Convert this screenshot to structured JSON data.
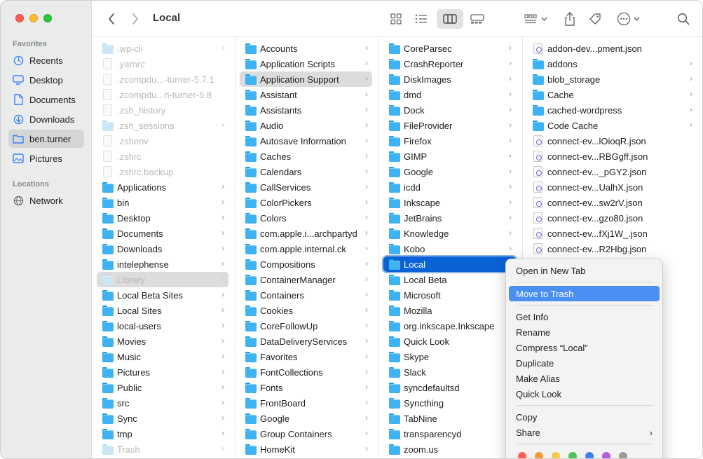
{
  "window": {
    "title": "Local"
  },
  "sidebar": {
    "favorites_label": "Favorites",
    "locations_label": "Locations",
    "favorites": [
      {
        "label": "Recents",
        "icon": "clock-icon"
      },
      {
        "label": "Desktop",
        "icon": "desktop-icon"
      },
      {
        "label": "Documents",
        "icon": "document-icon"
      },
      {
        "label": "Downloads",
        "icon": "download-icon"
      },
      {
        "label": "ben.turner",
        "icon": "home-folder-icon",
        "selected": true
      },
      {
        "label": "Pictures",
        "icon": "pictures-icon"
      }
    ],
    "locations": [
      {
        "label": "Network",
        "icon": "network-icon"
      }
    ]
  },
  "columns": [
    {
      "items": [
        {
          "name": ".wp-cli",
          "kind": "folder",
          "dim": true,
          "chevron": true
        },
        {
          "name": ".yarnrc",
          "kind": "doc",
          "dim": true
        },
        {
          "name": ".zcompdu...-turner-5.7.1",
          "kind": "doc",
          "dim": true
        },
        {
          "name": ".zcompdu...n-turner-5.8",
          "kind": "doc",
          "dim": true
        },
        {
          "name": ".zsh_history",
          "kind": "doc",
          "dim": true
        },
        {
          "name": ".zsh_sessions",
          "kind": "folder",
          "dim": true,
          "chevron": true
        },
        {
          "name": ".zshenv",
          "kind": "doc",
          "dim": true
        },
        {
          "name": ".zshrc",
          "kind": "doc",
          "dim": true
        },
        {
          "name": ".zshrc.backup",
          "kind": "doc",
          "dim": true
        },
        {
          "name": "Applications",
          "kind": "folder",
          "chevron": true
        },
        {
          "name": "bin",
          "kind": "folder",
          "chevron": true
        },
        {
          "name": "Desktop",
          "kind": "folder",
          "chevron": true
        },
        {
          "name": "Documents",
          "kind": "folder",
          "chevron": true
        },
        {
          "name": "Downloads",
          "kind": "folder",
          "chevron": true
        },
        {
          "name": "intelephense",
          "kind": "folder",
          "chevron": true
        },
        {
          "name": "Library",
          "kind": "folder",
          "dim": true,
          "chevron": true,
          "selected": "grey"
        },
        {
          "name": "Local Beta Sites",
          "kind": "folder",
          "chevron": true
        },
        {
          "name": "Local Sites",
          "kind": "folder",
          "chevron": true
        },
        {
          "name": "local-users",
          "kind": "folder",
          "chevron": true
        },
        {
          "name": "Movies",
          "kind": "folder",
          "chevron": true
        },
        {
          "name": "Music",
          "kind": "folder",
          "chevron": true
        },
        {
          "name": "Pictures",
          "kind": "folder",
          "chevron": true
        },
        {
          "name": "Public",
          "kind": "folder",
          "chevron": true
        },
        {
          "name": "src",
          "kind": "folder",
          "chevron": true
        },
        {
          "name": "Sync",
          "kind": "folder",
          "chevron": true
        },
        {
          "name": "tmp",
          "kind": "folder",
          "chevron": true
        },
        {
          "name": "Trash",
          "kind": "folder",
          "dim": true,
          "chevron": true
        }
      ]
    },
    {
      "items": [
        {
          "name": "Accounts",
          "kind": "folder",
          "chevron": true
        },
        {
          "name": "Application Scripts",
          "kind": "folder",
          "chevron": true
        },
        {
          "name": "Application Support",
          "kind": "folder",
          "chevron": true,
          "selected": "grey"
        },
        {
          "name": "Assistant",
          "kind": "folder",
          "chevron": true
        },
        {
          "name": "Assistants",
          "kind": "folder",
          "chevron": true
        },
        {
          "name": "Audio",
          "kind": "folder",
          "chevron": true
        },
        {
          "name": "Autosave Information",
          "kind": "folder",
          "chevron": true
        },
        {
          "name": "Caches",
          "kind": "folder",
          "chevron": true
        },
        {
          "name": "Calendars",
          "kind": "folder",
          "chevron": true
        },
        {
          "name": "CallServices",
          "kind": "folder",
          "chevron": true
        },
        {
          "name": "ColorPickers",
          "kind": "folder",
          "chevron": true
        },
        {
          "name": "Colors",
          "kind": "folder",
          "chevron": true
        },
        {
          "name": "com.apple.i...archpartyd",
          "kind": "folder",
          "chevron": true
        },
        {
          "name": "com.apple.internal.ck",
          "kind": "folder",
          "chevron": true
        },
        {
          "name": "Compositions",
          "kind": "folder",
          "chevron": true
        },
        {
          "name": "ContainerManager",
          "kind": "folder",
          "chevron": true
        },
        {
          "name": "Containers",
          "kind": "folder",
          "chevron": true
        },
        {
          "name": "Cookies",
          "kind": "folder",
          "chevron": true
        },
        {
          "name": "CoreFollowUp",
          "kind": "folder",
          "chevron": true
        },
        {
          "name": "DataDeliveryServices",
          "kind": "folder",
          "chevron": true
        },
        {
          "name": "Favorites",
          "kind": "folder",
          "chevron": true
        },
        {
          "name": "FontCollections",
          "kind": "folder",
          "chevron": true
        },
        {
          "name": "Fonts",
          "kind": "folder",
          "chevron": true
        },
        {
          "name": "FrontBoard",
          "kind": "folder",
          "chevron": true
        },
        {
          "name": "Google",
          "kind": "folder",
          "chevron": true
        },
        {
          "name": "Group Containers",
          "kind": "folder",
          "chevron": true
        },
        {
          "name": "HomeKit",
          "kind": "folder",
          "chevron": true
        }
      ]
    },
    {
      "items": [
        {
          "name": "CoreParsec",
          "kind": "folder",
          "chevron": true
        },
        {
          "name": "CrashReporter",
          "kind": "folder",
          "chevron": true
        },
        {
          "name": "DiskImages",
          "kind": "folder",
          "chevron": true
        },
        {
          "name": "dmd",
          "kind": "folder",
          "chevron": true
        },
        {
          "name": "Dock",
          "kind": "folder",
          "chevron": true
        },
        {
          "name": "FileProvider",
          "kind": "folder",
          "chevron": true
        },
        {
          "name": "Firefox",
          "kind": "folder",
          "chevron": true
        },
        {
          "name": "GIMP",
          "kind": "folder",
          "chevron": true
        },
        {
          "name": "Google",
          "kind": "folder",
          "chevron": true
        },
        {
          "name": "icdd",
          "kind": "folder",
          "chevron": true
        },
        {
          "name": "Inkscape",
          "kind": "folder",
          "chevron": true
        },
        {
          "name": "JetBrains",
          "kind": "folder",
          "chevron": true
        },
        {
          "name": "Knowledge",
          "kind": "folder",
          "chevron": true
        },
        {
          "name": "Kobo",
          "kind": "folder",
          "chevron": true
        },
        {
          "name": "Local",
          "kind": "folder",
          "chevron": true,
          "selected": "blue"
        },
        {
          "name": "Local Beta",
          "kind": "folder",
          "chevron": true
        },
        {
          "name": "Microsoft",
          "kind": "folder",
          "chevron": true
        },
        {
          "name": "Mozilla",
          "kind": "folder",
          "chevron": true
        },
        {
          "name": "org.inkscape.Inkscape",
          "kind": "folder",
          "chevron": true
        },
        {
          "name": "Quick Look",
          "kind": "folder",
          "chevron": true
        },
        {
          "name": "Skype",
          "kind": "folder",
          "chevron": true
        },
        {
          "name": "Slack",
          "kind": "folder",
          "chevron": true
        },
        {
          "name": "syncdefaultsd",
          "kind": "folder",
          "chevron": true
        },
        {
          "name": "Syncthing",
          "kind": "folder",
          "chevron": true
        },
        {
          "name": "TabNine",
          "kind": "folder",
          "chevron": true
        },
        {
          "name": "transparencyd",
          "kind": "folder",
          "chevron": true
        },
        {
          "name": "zoom.us",
          "kind": "folder",
          "chevron": true
        }
      ]
    },
    {
      "items": [
        {
          "name": "addon-dev...pment.json",
          "kind": "json"
        },
        {
          "name": "addons",
          "kind": "folder",
          "chevron": true
        },
        {
          "name": "blob_storage",
          "kind": "folder",
          "chevron": true
        },
        {
          "name": "Cache",
          "kind": "folder",
          "chevron": true
        },
        {
          "name": "cached-wordpress",
          "kind": "folder",
          "chevron": true
        },
        {
          "name": "Code Cache",
          "kind": "folder",
          "chevron": true
        },
        {
          "name": "connect-ev...lOioqR.json",
          "kind": "json"
        },
        {
          "name": "connect-ev...RBGgff.json",
          "kind": "json"
        },
        {
          "name": "connect-ev..._pGY2.json",
          "kind": "json"
        },
        {
          "name": "connect-ev...UalhX.json",
          "kind": "json"
        },
        {
          "name": "connect-ev...sw2rV.json",
          "kind": "json"
        },
        {
          "name": "connect-ev...gzo80.json",
          "kind": "json"
        },
        {
          "name": "connect-ev...fXj1W_.json",
          "kind": "json"
        },
        {
          "name": "connect-ev...R2Hbg.json",
          "kind": "json"
        }
      ]
    }
  ],
  "context_menu": {
    "items": [
      {
        "label": "Open in New Tab",
        "type": "item"
      },
      {
        "type": "separator"
      },
      {
        "label": "Move to Trash",
        "type": "item",
        "highlighted": true
      },
      {
        "type": "separator"
      },
      {
        "label": "Get Info",
        "type": "item"
      },
      {
        "label": "Rename",
        "type": "item"
      },
      {
        "label": "Compress “Local”",
        "type": "item"
      },
      {
        "label": "Duplicate",
        "type": "item"
      },
      {
        "label": "Make Alias",
        "type": "item"
      },
      {
        "label": "Quick Look",
        "type": "item"
      },
      {
        "type": "separator"
      },
      {
        "label": "Copy",
        "type": "item"
      },
      {
        "label": "Share",
        "type": "item",
        "submenu": true
      },
      {
        "type": "separator"
      }
    ],
    "tag_colors": [
      "#fe5f57",
      "#f39c34",
      "#f6c940",
      "#4bc35a",
      "#3b82f6",
      "#b35ddd",
      "#9a9a9a"
    ]
  }
}
